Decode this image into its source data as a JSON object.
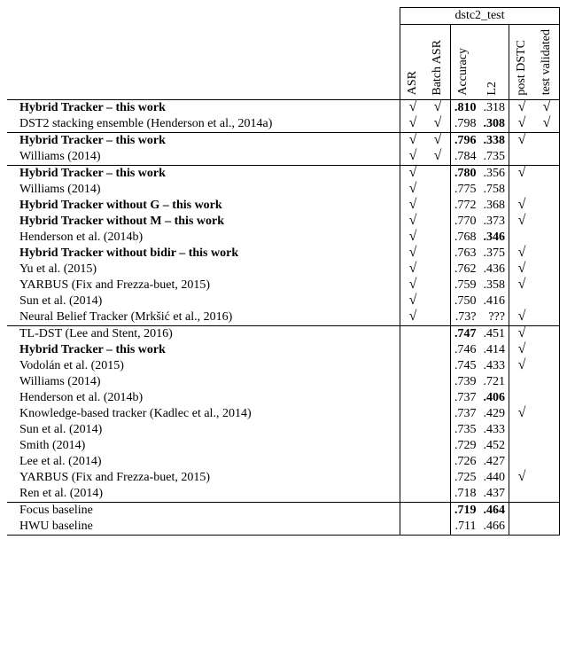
{
  "header": {
    "top": "dstc2_test",
    "cols": [
      "ASR",
      "Batch ASR",
      "Accuracy",
      "L2",
      "post DSTC",
      "test validated"
    ]
  },
  "check_glyph": "√",
  "groups": [
    {
      "rows": [
        {
          "name": "Hybrid Tracker – this work",
          "bold": true,
          "asr": true,
          "batch": true,
          "acc": ".810",
          "acc_bold": true,
          "l2": ".318",
          "post": true,
          "tv": true
        },
        {
          "name": "DST2 stacking ensemble (Henderson et al., 2014a)",
          "asr": true,
          "batch": true,
          "acc": ".798",
          "l2": ".308",
          "l2_bold": true,
          "post": true,
          "tv": true
        }
      ]
    },
    {
      "rows": [
        {
          "name": "Hybrid Tracker – this work",
          "bold": true,
          "asr": true,
          "batch": true,
          "acc": ".796",
          "acc_bold": true,
          "l2": ".338",
          "l2_bold": true,
          "post": true
        },
        {
          "name": "Williams (2014)",
          "asr": true,
          "batch": true,
          "acc": ".784",
          "l2": ".735"
        }
      ]
    },
    {
      "rows": [
        {
          "name": "Hybrid Tracker – this work",
          "bold": true,
          "asr": true,
          "acc": ".780",
          "acc_bold": true,
          "l2": ".356",
          "post": true
        },
        {
          "name": "Williams (2014)",
          "asr": true,
          "acc": ".775",
          "l2": ".758"
        },
        {
          "name": "Hybrid Tracker without G – this work",
          "bold": true,
          "asr": true,
          "acc": ".772",
          "l2": ".368",
          "post": true
        },
        {
          "name": "Hybrid Tracker without M – this work",
          "bold": true,
          "asr": true,
          "acc": ".770",
          "l2": ".373",
          "post": true
        },
        {
          "name": "Henderson et al. (2014b)",
          "asr": true,
          "acc": ".768",
          "l2": ".346",
          "l2_bold": true
        },
        {
          "name": "Hybrid Tracker without bidir – this work",
          "bold": true,
          "asr": true,
          "acc": ".763",
          "l2": ".375",
          "post": true
        },
        {
          "name": "Yu et al. (2015)",
          "asr": true,
          "acc": ".762",
          "l2": ".436",
          "post": true
        },
        {
          "name": "YARBUS (Fix and Frezza-buet, 2015)",
          "asr": true,
          "acc": ".759",
          "l2": ".358",
          "post": true
        },
        {
          "name": "Sun et al. (2014)",
          "asr": true,
          "acc": ".750",
          "l2": ".416"
        },
        {
          "name": "Neural Belief Tracker (Mrkšić et al., 2016)",
          "asr": true,
          "acc": ".73?",
          "l2": "???",
          "post": true
        }
      ]
    },
    {
      "rows": [
        {
          "name": "TL-DST (Lee and Stent, 2016)",
          "acc": ".747",
          "acc_bold": true,
          "l2": ".451",
          "post": true
        },
        {
          "name": "Hybrid Tracker – this work",
          "bold": true,
          "acc": ".746",
          "l2": ".414",
          "post": true
        },
        {
          "name": "Vodolán et al. (2015)",
          "acc": ".745",
          "l2": ".433",
          "post": true
        },
        {
          "name": "Williams (2014)",
          "acc": ".739",
          "l2": ".721"
        },
        {
          "name": "Henderson et al. (2014b)",
          "acc": ".737",
          "l2": ".406",
          "l2_bold": true
        },
        {
          "name": "Knowledge-based tracker (Kadlec et al., 2014)",
          "acc": ".737",
          "l2": ".429",
          "post": true
        },
        {
          "name": "Sun et al. (2014)",
          "acc": ".735",
          "l2": ".433"
        },
        {
          "name": "Smith (2014)",
          "acc": ".729",
          "l2": ".452"
        },
        {
          "name": "Lee et al. (2014)",
          "acc": ".726",
          "l2": ".427"
        },
        {
          "name": "YARBUS (Fix and Frezza-buet, 2015)",
          "acc": ".725",
          "l2": ".440",
          "post": true
        },
        {
          "name": "Ren et al. (2014)",
          "acc": ".718",
          "l2": ".437"
        }
      ]
    },
    {
      "rows": [
        {
          "name": "Focus baseline",
          "acc": ".719",
          "acc_bold": true,
          "l2": ".464",
          "l2_bold": true
        },
        {
          "name": "HWU baseline",
          "acc": ".711",
          "l2": ".466"
        }
      ]
    }
  ]
}
